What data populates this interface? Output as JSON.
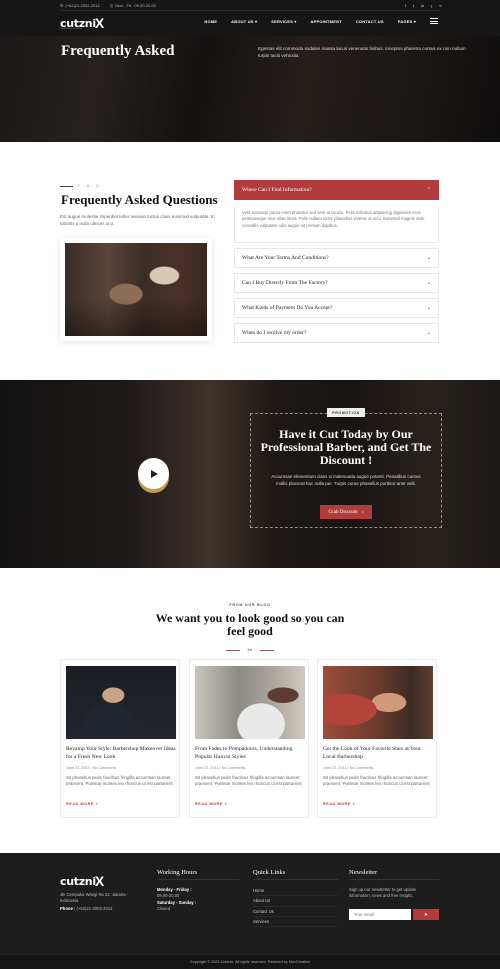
{
  "header": {
    "phone": "(+62)21-2002-2012",
    "hours": "Mon - Fri : 09.00-20.00",
    "social": [
      "facebook-icon",
      "twitter-icon",
      "linkedin-icon",
      "rss-icon",
      "more-icon"
    ],
    "logo": "cutzni",
    "logo_mark": "X",
    "logo_tagline": "The Professional Barber",
    "nav": [
      {
        "label": "HOME",
        "dropdown": false
      },
      {
        "label": "ABOUT US",
        "dropdown": true
      },
      {
        "label": "SERVICES",
        "dropdown": true
      },
      {
        "label": "APPOINTMENT",
        "dropdown": false
      },
      {
        "label": "CONTACT US",
        "dropdown": false
      },
      {
        "label": "PAGES",
        "dropdown": true
      }
    ],
    "dropdown_glyph": "▾"
  },
  "hero": {
    "title": "Frequently Asked",
    "description": "Egestas elit commodo sodales massa lacus venenatis finibus. Inceptos pharetra cursus ex non nullam turpis taciti vehicula."
  },
  "faq": {
    "eyebrow": "F . A . Q",
    "title": "Frequently Asked Questions",
    "description": "Est augue molestie imperdiet tellus aenean luctus class euismod vulputate. In lobortis a nulla ultrices orci.",
    "items": [
      {
        "q": "Where Can I Find Information?",
        "open": true,
        "a": "Velit sociosqu purus enim pharetra sed sem at iaculis. Felis ridiculus adipiscing dignissim eros pellentesque mus vitae litora. Felis nullam tortor phasellus viverra ut arcu. Euismod magnis ante convallis vulputate odio augue sit pretium dapibus."
      },
      {
        "q": "What Are Your Terms And Conditions?",
        "open": false
      },
      {
        "q": "Can I Buy Directly From The Factory?",
        "open": false
      },
      {
        "q": "What Kinds of Payment Do You Accept?",
        "open": false
      },
      {
        "q": "When do I receive my order?",
        "open": false
      }
    ],
    "chev_up": "⌃",
    "chev_down": "⌄"
  },
  "promo": {
    "badge": "PROMOTION",
    "title": "Have it Cut Today by Our Professional Barber, and Get The Discount !",
    "description": "Accumsan elementum class si malesuada augue potenti. Penatibus cursus mollis placerat hac nulla per. Turpis curae phasellus porttitor ante velit.",
    "button": "Grab Discount",
    "button_icon": "›"
  },
  "blog": {
    "eyebrow": "FROM OUR BLOG",
    "title": "We want you to look good so you can feel good",
    "divider_glyph": "✂",
    "posts": [
      {
        "title": "Revamp Your Style: Barbershop Makeover Ideas for a Fresh New Look",
        "meta": "June 23, 2023 • No Comments",
        "excerpt": "Sit phasellus pede faucibus fringilla accumsan laoreet praesent. Pulvinar montes leo rhoncus ut est parturient",
        "more": "READ MORE »"
      },
      {
        "title": "From Fades to Pompadours, Understanding Popular Haircut Styles",
        "meta": "June 23, 2023 • No Comments",
        "excerpt": "Sit phasellus pede faucibus fringilla accumsan laoreet praesent. Pulvinar montes leo rhoncus ut est parturient",
        "more": "READ MORE »"
      },
      {
        "title": "Get the Look of Your Favorite Stars at Your Local Barbershop",
        "meta": "June 23, 2023 • No Comments",
        "excerpt": "Sit phasellus pede faucibus fringilla accumsan laoreet praesent. Pulvinar montes leo rhoncus ut est parturient",
        "more": "READ MORE »"
      }
    ]
  },
  "footer": {
    "address": "Jln Cempaka Wangi No 22, Jakarta - Indonesia",
    "phone_label": "Phone :",
    "phone": "(+62)21-2002-2012",
    "hours_title": "Working Hours",
    "weekday_label": "Monday - Friday :",
    "weekday_hours": "09.00-20.00",
    "weekend_label": "Saturday - Sunday :",
    "weekend_hours": "Closed",
    "links_title": "Quick Links",
    "links": [
      "Home",
      "About Us",
      "Contact Us",
      "Services"
    ],
    "newsletter_title": "Newsletter",
    "newsletter_text": "Sign up our newsletter to get update information, news and free insight.",
    "email_placeholder": "Your email",
    "copyright": "Copyright © 2023 Cutznix, All rights reserved. Powered by MoxCreative"
  },
  "colors": {
    "accent": "#b23b3b",
    "dark": "#161616",
    "footer": "#1d1d1d"
  }
}
